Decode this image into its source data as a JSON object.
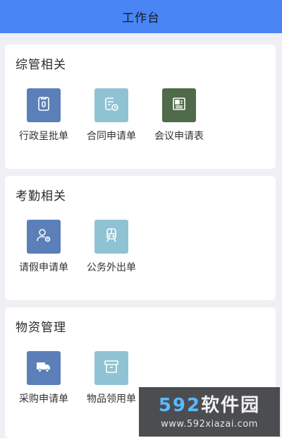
{
  "header": {
    "title": "工作台"
  },
  "sections": [
    {
      "title": "综管相关",
      "items": [
        {
          "label": "行政呈批单",
          "icon": "clipboard-icon",
          "color": "#5b7fb8"
        },
        {
          "label": "合同申请单",
          "icon": "contract-clock-icon",
          "color": "#8fc3d4"
        },
        {
          "label": "会议申请表",
          "icon": "newspaper-icon",
          "color": "#4f6b4a"
        }
      ]
    },
    {
      "title": "考勤相关",
      "items": [
        {
          "label": "请假申请单",
          "icon": "person-leave-icon",
          "color": "#5b7fb8"
        },
        {
          "label": "公务外出单",
          "icon": "train-icon",
          "color": "#8fc3d4"
        }
      ]
    },
    {
      "title": "物资管理",
      "items": [
        {
          "label": "采购申请单",
          "icon": "truck-icon",
          "color": "#5b7fb8"
        },
        {
          "label": "物品领用单",
          "icon": "archive-box-icon",
          "color": "#8fc3d4"
        }
      ]
    }
  ],
  "watermark": {
    "digits": "592",
    "brand": "软件园",
    "url": "www.592xiazai.com"
  }
}
